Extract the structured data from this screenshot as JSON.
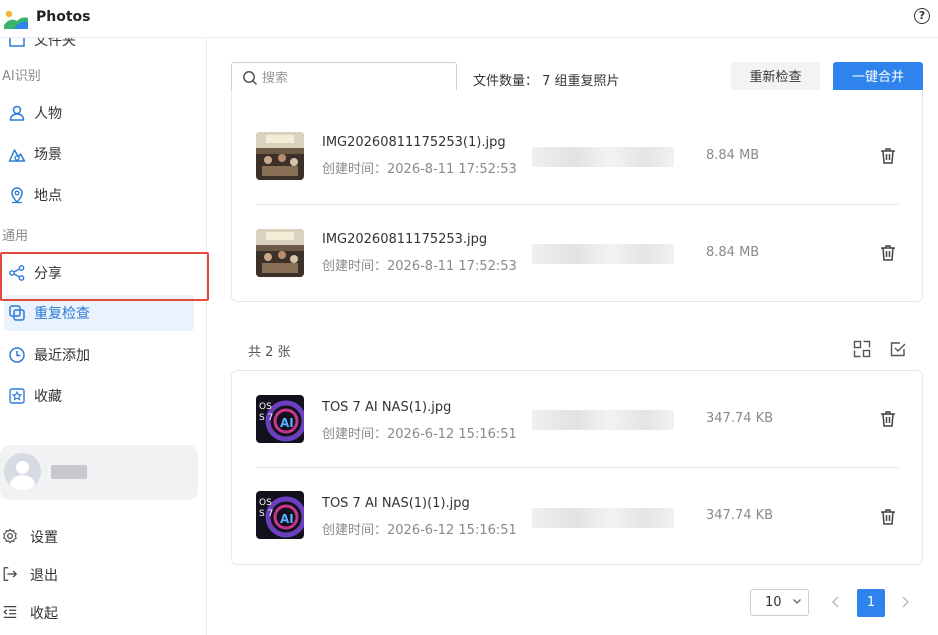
{
  "app": {
    "title": "Photos"
  },
  "sidebar": {
    "truncated_label": "文件夹",
    "section_ai": "AI识别",
    "ai_items": [
      {
        "label": "人物",
        "icon": "person-icon"
      },
      {
        "label": "场景",
        "icon": "scene-icon"
      },
      {
        "label": "地点",
        "icon": "location-icon"
      }
    ],
    "section_general": "通用",
    "general_items": [
      {
        "label": "分享",
        "icon": "share-icon"
      },
      {
        "label": "重复检查",
        "icon": "duplicate-icon",
        "active": true
      },
      {
        "label": "最近添加",
        "icon": "clock-icon"
      },
      {
        "label": "收藏",
        "icon": "star-icon"
      }
    ],
    "bottom_items": [
      {
        "label": "设置",
        "icon": "gear-icon"
      },
      {
        "label": "退出",
        "icon": "logout-icon"
      },
      {
        "label": "收起",
        "icon": "collapse-icon"
      }
    ]
  },
  "toolbar": {
    "search_placeholder": "搜索",
    "file_count": "文件数量： 7 组重复照片",
    "recheck_label": "重新检查",
    "merge_label": "一键合并"
  },
  "groups": [
    {
      "count_label": "",
      "files": [
        {
          "name": "IMG20260811175253(1).jpg",
          "created": "创建时间：2026-8-11 17:52:53",
          "size": "8.84 MB"
        },
        {
          "name": "IMG20260811175253.jpg",
          "created": "创建时间：2026-8-11 17:52:53",
          "size": "8.84 MB"
        }
      ]
    },
    {
      "count_label": "共 2 张",
      "files": [
        {
          "name": "TOS 7 AI NAS(1).jpg",
          "created": "创建时间：2026-6-12 15:16:51",
          "size": "347.74 KB"
        },
        {
          "name": "TOS 7 AI NAS(1)(1).jpg",
          "created": "创建时间：2026-6-12 15:16:51",
          "size": "347.74 KB"
        }
      ]
    }
  ],
  "pagination": {
    "page_size": "10",
    "current_page": "1"
  },
  "colors": {
    "accent": "#2f83ec",
    "highlight": "#e14a3d"
  }
}
